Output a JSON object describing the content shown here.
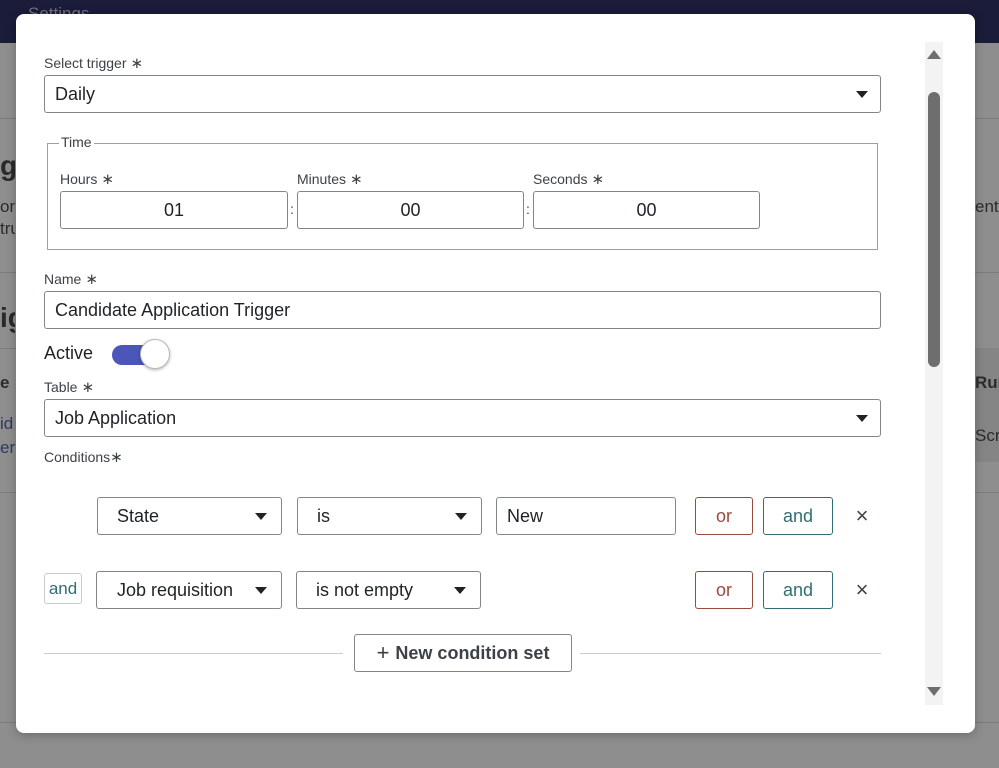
{
  "background": {
    "topbar_title": "Settings",
    "fragments": [
      "g",
      "on",
      "tru",
      "ig",
      "e",
      "id",
      "er",
      "ent",
      "Run",
      "Scr"
    ]
  },
  "trigger": {
    "label": "Select trigger",
    "value": "Daily"
  },
  "time": {
    "legend": "Time",
    "hours_label": "Hours",
    "hours_value": "01",
    "minutes_label": "Minutes",
    "minutes_value": "00",
    "seconds_label": "Seconds",
    "seconds_value": "00",
    "separator": ":"
  },
  "name": {
    "label": "Name",
    "value": "Candidate Application Trigger"
  },
  "active": {
    "label": "Active",
    "on": true
  },
  "table": {
    "label": "Table",
    "value": "Job Application"
  },
  "conditions": {
    "label": "Conditions",
    "required_mark": "∗",
    "rows": [
      {
        "field": "State",
        "operator": "is",
        "value": "New",
        "or_label": "or",
        "and_label": "and"
      },
      {
        "join": "and",
        "field": "Job requisition",
        "operator": "is not empty",
        "or_label": "or",
        "and_label": "and"
      }
    ],
    "new_set_label": "New condition set"
  },
  "required_mark": "∗",
  "colors": {
    "accent": "#4c56b8",
    "or": "#9b4a3e",
    "and": "#2f6f73"
  },
  "icons": {
    "close": "close-icon",
    "caret": "chevron-down-icon",
    "plus": "plus-icon"
  }
}
